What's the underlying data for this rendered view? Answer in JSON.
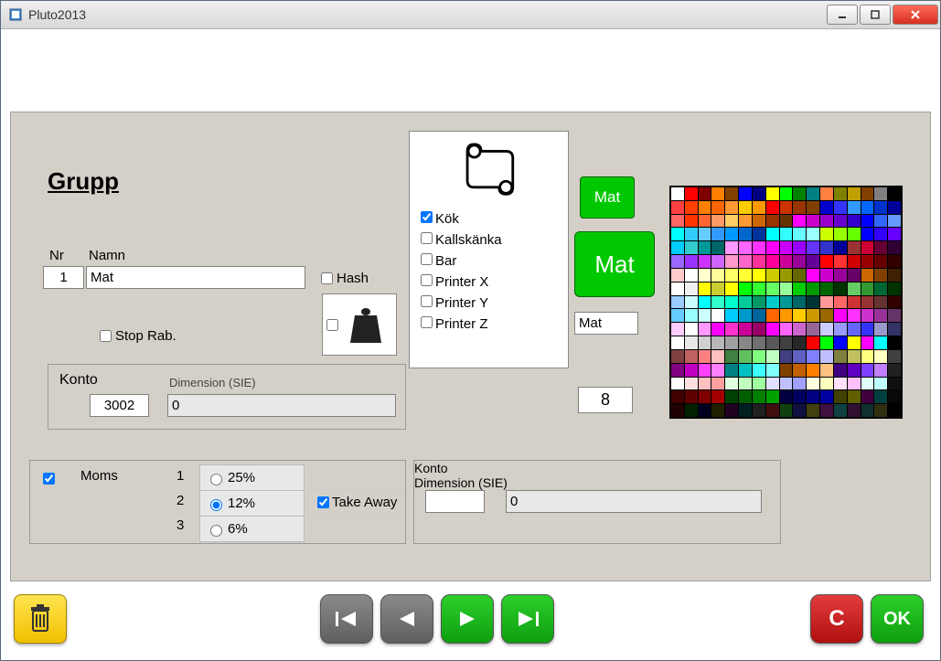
{
  "window": {
    "title": "Pluto2013"
  },
  "heading": "Grupp",
  "labels": {
    "nr": "Nr",
    "namn": "Namn",
    "hash": "Hash",
    "stopRab": "Stop Rab.",
    "konto": "Konto",
    "dimension": "Dimension (SIE)",
    "moms": "Moms",
    "takeAway": "Take Away"
  },
  "fields": {
    "nr": "1",
    "namn": "Mat",
    "konto": "3002",
    "dimension": "0",
    "colorIndex": "8",
    "previewText": "Mat",
    "konto2": "",
    "dimension2": "0"
  },
  "checks": {
    "hash": false,
    "stopRab": false,
    "weight": false,
    "momsEnabled": true,
    "takeAway": true
  },
  "printers": [
    {
      "label": "Kök",
      "checked": true
    },
    {
      "label": "Kallskänka",
      "checked": false
    },
    {
      "label": "Bar",
      "checked": false
    },
    {
      "label": "Printer X",
      "checked": false
    },
    {
      "label": "Printer Y",
      "checked": false
    },
    {
      "label": "Printer Z",
      "checked": false
    }
  ],
  "moms": {
    "rows": [
      "1",
      "2",
      "3"
    ],
    "options": [
      {
        "label": "25%",
        "selected": false
      },
      {
        "label": "12%",
        "selected": true
      },
      {
        "label": "6%",
        "selected": false
      }
    ]
  },
  "buttons": {
    "smallPreview": "Mat",
    "bigPreview": "Mat",
    "cancel": "C",
    "ok": "OK"
  },
  "colorPalette": [
    "#ffffff",
    "#ff0000",
    "#800000",
    "#ff8000",
    "#804000",
    "#0000ff",
    "#000080",
    "#ffff00",
    "#00ff00",
    "#008000",
    "#008080",
    "#ff8040",
    "#808000",
    "#c0a000",
    "#804000",
    "#808080",
    "#000000",
    "#ff4040",
    "#ff4000",
    "#ff8000",
    "#ff6600",
    "#ff9933",
    "#ffcc00",
    "#ff9900",
    "#ff0000",
    "#cc3300",
    "#993300",
    "#804000",
    "#0000cc",
    "#3333ff",
    "#3399ff",
    "#0066ff",
    "#0033cc",
    "#000099",
    "#ff6666",
    "#ff3300",
    "#ff6633",
    "#ff9966",
    "#ffcc66",
    "#ff9933",
    "#cc6600",
    "#993300",
    "#663300",
    "#ff00ff",
    "#cc00cc",
    "#9900cc",
    "#6600cc",
    "#3300cc",
    "#0000ff",
    "#3366ff",
    "#6699ff",
    "#00ffff",
    "#33ccff",
    "#66ccff",
    "#3399ff",
    "#0099ff",
    "#0066cc",
    "#003399",
    "#00ffff",
    "#33ffff",
    "#66ffff",
    "#99ffff",
    "#ccff00",
    "#99ff00",
    "#66ff00",
    "#0000ff",
    "#3300ff",
    "#6600ff",
    "#00ccff",
    "#33cccc",
    "#009999",
    "#006666",
    "#ff99ff",
    "#ff66ff",
    "#ff33ff",
    "#ff00ff",
    "#cc00ff",
    "#9900ff",
    "#6633ff",
    "#3333cc",
    "#000099",
    "#993333",
    "#cc0033",
    "#660033",
    "#330033",
    "#9966ff",
    "#9933ff",
    "#cc33ff",
    "#cc66ff",
    "#ff99cc",
    "#ff66cc",
    "#ff3399",
    "#ff0099",
    "#cc0099",
    "#990099",
    "#660099",
    "#ff0000",
    "#ff3333",
    "#cc0000",
    "#990000",
    "#660000",
    "#330000",
    "#ffcccc",
    "#ffffff",
    "#ffffcc",
    "#ffff99",
    "#ffff66",
    "#ffff33",
    "#ffff00",
    "#cccc00",
    "#999900",
    "#666600",
    "#ff00ff",
    "#cc00cc",
    "#990099",
    "#660066",
    "#cc6600",
    "#804000",
    "#402000",
    "#ffffff",
    "#f0f0f0",
    "#ffff00",
    "#cccc33",
    "#ffff00",
    "#00ff00",
    "#33ff33",
    "#66ff66",
    "#99ff99",
    "#00cc00",
    "#009900",
    "#006600",
    "#003300",
    "#66cc66",
    "#339933",
    "#006633",
    "#003300",
    "#99ccff",
    "#ccffff",
    "#00ffff",
    "#33ffcc",
    "#00ffcc",
    "#00cc99",
    "#009966",
    "#00cccc",
    "#009999",
    "#006666",
    "#003333",
    "#ff9999",
    "#ff6666",
    "#cc3333",
    "#993333",
    "#663333",
    "#330000",
    "#66ccff",
    "#99ffff",
    "#ccffff",
    "#ffffff",
    "#00ccff",
    "#0099cc",
    "#006699",
    "#ff6600",
    "#ff9900",
    "#ffcc00",
    "#cc9900",
    "#996600",
    "#ff00ff",
    "#ff33ff",
    "#cc33cc",
    "#993399",
    "#663366",
    "#ffccff",
    "#ffffff",
    "#ff99ff",
    "#ff00ff",
    "#ff33cc",
    "#cc0099",
    "#990066",
    "#ff00ff",
    "#ff66ff",
    "#cc66cc",
    "#996699",
    "#ccccff",
    "#9999ff",
    "#6666ff",
    "#3333ff",
    "#9999cc",
    "#333366",
    "#ffffff",
    "#e8e8e8",
    "#d0d0d0",
    "#b8b8b8",
    "#a0a0a0",
    "#888888",
    "#707070",
    "#585858",
    "#404040",
    "#282828",
    "#ff0000",
    "#00ff00",
    "#0000ff",
    "#ffff00",
    "#ff00ff",
    "#00ffff",
    "#000000",
    "#804040",
    "#c06060",
    "#ff8080",
    "#ffc0c0",
    "#408040",
    "#60c060",
    "#80ff80",
    "#c0ffc0",
    "#404080",
    "#6060c0",
    "#8080ff",
    "#c0c0ff",
    "#808040",
    "#c0c060",
    "#ffff80",
    "#ffffc0",
    "#404040",
    "#800080",
    "#c000c0",
    "#ff40ff",
    "#ff80ff",
    "#008080",
    "#00c0c0",
    "#40ffff",
    "#80ffff",
    "#804000",
    "#c06000",
    "#ff8000",
    "#ffc080",
    "#400080",
    "#6000c0",
    "#8040ff",
    "#c080ff",
    "#202020",
    "#ffffff",
    "#ffe0e0",
    "#ffc0c0",
    "#ffa0a0",
    "#e0ffe0",
    "#c0ffc0",
    "#a0ffa0",
    "#e0e0ff",
    "#c0c0ff",
    "#a0a0ff",
    "#ffffe0",
    "#ffffc0",
    "#ffe0ff",
    "#ffc0ff",
    "#e0ffff",
    "#c0ffff",
    "#101010",
    "#400000",
    "#600000",
    "#800000",
    "#a00000",
    "#004000",
    "#006000",
    "#008000",
    "#00a000",
    "#000040",
    "#000060",
    "#000080",
    "#0000a0",
    "#404000",
    "#606000",
    "#400040",
    "#004040",
    "#080808",
    "#200000",
    "#002000",
    "#000020",
    "#202000",
    "#200020",
    "#002020",
    "#202020",
    "#401010",
    "#104010",
    "#101040",
    "#404010",
    "#401040",
    "#104040",
    "#301030",
    "#103030",
    "#303010",
    "#000000"
  ]
}
